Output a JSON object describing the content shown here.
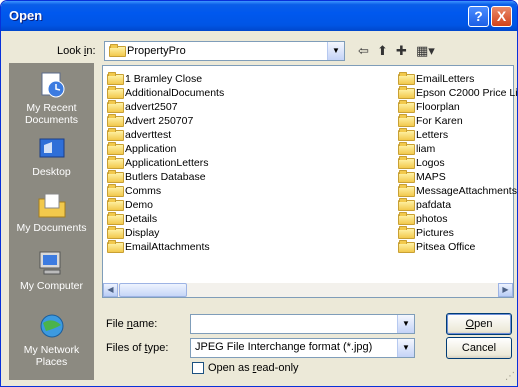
{
  "dialog": {
    "title": "Open",
    "help_button": "?",
    "close_button": "X"
  },
  "look_in": {
    "label_prefix": "Look ",
    "label_accel": "i",
    "label_suffix": "n:",
    "value": "PropertyPro"
  },
  "toolbar": {
    "back_icon": "back-arrow-icon",
    "up_icon": "up-folder-icon",
    "new_folder_icon": "new-folder-icon",
    "views_icon": "views-menu-icon"
  },
  "places": [
    {
      "label": "My Recent Documents",
      "icon": "recent-documents-icon"
    },
    {
      "label": "Desktop",
      "icon": "desktop-icon"
    },
    {
      "label": "My Documents",
      "icon": "my-documents-icon"
    },
    {
      "label": "My Computer",
      "icon": "my-computer-icon"
    },
    {
      "label": "My Network Places",
      "icon": "network-places-icon"
    }
  ],
  "files_col1": [
    "1 Bramley Close",
    "AdditionalDocuments",
    "advert2507",
    "Advert 250707",
    "adverttest",
    "Application",
    "ApplicationLetters",
    "Butlers Database",
    "Comms",
    "Demo",
    "Details",
    "Display",
    "EmailAttachments"
  ],
  "files_col2": [
    "EmailLetters",
    "Epson C2000 Price List",
    "Floorplan",
    "For Karen",
    "Letters",
    "liam",
    "Logos",
    "MAPS",
    "MessageAttachments",
    "pafdata",
    "photos",
    "Pictures",
    "Pitsea Office"
  ],
  "file_name": {
    "label_prefix": "File ",
    "label_accel": "n",
    "label_suffix": "ame:",
    "value": ""
  },
  "file_type": {
    "label_prefix": "Files of ",
    "label_accel": "t",
    "label_suffix": "ype:",
    "value": "JPEG File Interchange format (*.jpg)"
  },
  "read_only": {
    "label_prefix": "Open as ",
    "label_accel": "r",
    "label_suffix": "ead-only",
    "checked": false
  },
  "buttons": {
    "open_accel": "O",
    "open_rest": "pen",
    "cancel": "Cancel"
  },
  "colors": {
    "title_bar": "#0055e5",
    "places_bar": "#8c8a81",
    "dialog_bg": "#ece9d8"
  }
}
